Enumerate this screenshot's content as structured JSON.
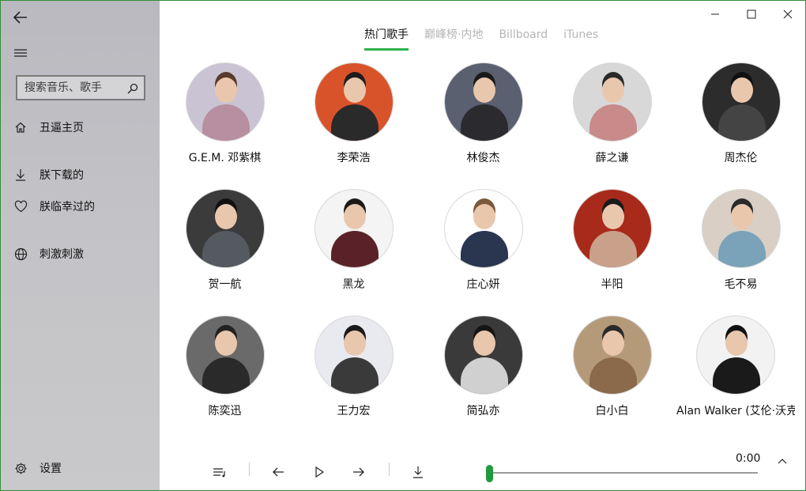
{
  "sidebar": {
    "search": {
      "placeholder": "搜索音乐、歌手"
    },
    "items": [
      {
        "label": "丑逼主页",
        "icon": "home-icon"
      },
      {
        "label": "朕下载的",
        "icon": "download-icon"
      },
      {
        "label": "朕临幸过的",
        "icon": "heart-icon"
      },
      {
        "label": "刺激刺激",
        "icon": "globe-icon"
      }
    ],
    "settings_label": "设置"
  },
  "tabs": [
    {
      "label": "热门歌手",
      "active": true
    },
    {
      "label": "巅峰榜·内地",
      "active": false
    },
    {
      "label": "Billboard",
      "active": false
    },
    {
      "label": "iTunes",
      "active": false
    }
  ],
  "artists": [
    {
      "name": "G.E.M. 邓紫棋",
      "bg": "#c9c3d3",
      "hair": "#5a3a2e",
      "cloth": "#b88fa0"
    },
    {
      "name": "李荣浩",
      "bg": "#d9532a",
      "hair": "#1d1d1d",
      "cloth": "#2a2a2a"
    },
    {
      "name": "林俊杰",
      "bg": "#5a6070",
      "hair": "#1a1a1a",
      "cloth": "#2b2b2f"
    },
    {
      "name": "薛之谦",
      "bg": "#d8d8d8",
      "hair": "#2a2a2a",
      "cloth": "#c98a8a"
    },
    {
      "name": "周杰伦",
      "bg": "#2c2c2c",
      "hair": "#111111",
      "cloth": "#444444"
    },
    {
      "name": "贺一航",
      "bg": "#3b3b3b",
      "hair": "#111111",
      "cloth": "#555a60"
    },
    {
      "name": "黑龙",
      "bg": "#f4f4f4",
      "hair": "#1a1a1a",
      "cloth": "#5a2228"
    },
    {
      "name": "庄心妍",
      "bg": "#ffffff",
      "hair": "#7a5a3a",
      "cloth": "#2a3550"
    },
    {
      "name": "半阳",
      "bg": "#a82a1a",
      "hair": "#1a1a1a",
      "cloth": "#c9a08a"
    },
    {
      "name": "毛不易",
      "bg": "#d9cfc4",
      "hair": "#2a2a2a",
      "cloth": "#7aa2b8"
    },
    {
      "name": "陈奕迅",
      "bg": "#6a6a6a",
      "hair": "#222222",
      "cloth": "#2a2a2a"
    },
    {
      "name": "王力宏",
      "bg": "#e8eaf0",
      "hair": "#1a1a1a",
      "cloth": "#3a3a3a"
    },
    {
      "name": "简弘亦",
      "bg": "#3a3a3a",
      "hair": "#151515",
      "cloth": "#d0d0d0"
    },
    {
      "name": "白小白",
      "bg": "#b59a7a",
      "hair": "#2a2a2a",
      "cloth": "#8a6a4a"
    },
    {
      "name": "Alan Walker (艾伦·沃克)",
      "bg": "#f2f2f2",
      "hair": "#111111",
      "cloth": "#1a1a1a"
    }
  ],
  "player": {
    "time": "0:00",
    "progress": 0
  },
  "colors": {
    "accent": "#2fb34a",
    "sidebar": "#c3c3c7"
  }
}
